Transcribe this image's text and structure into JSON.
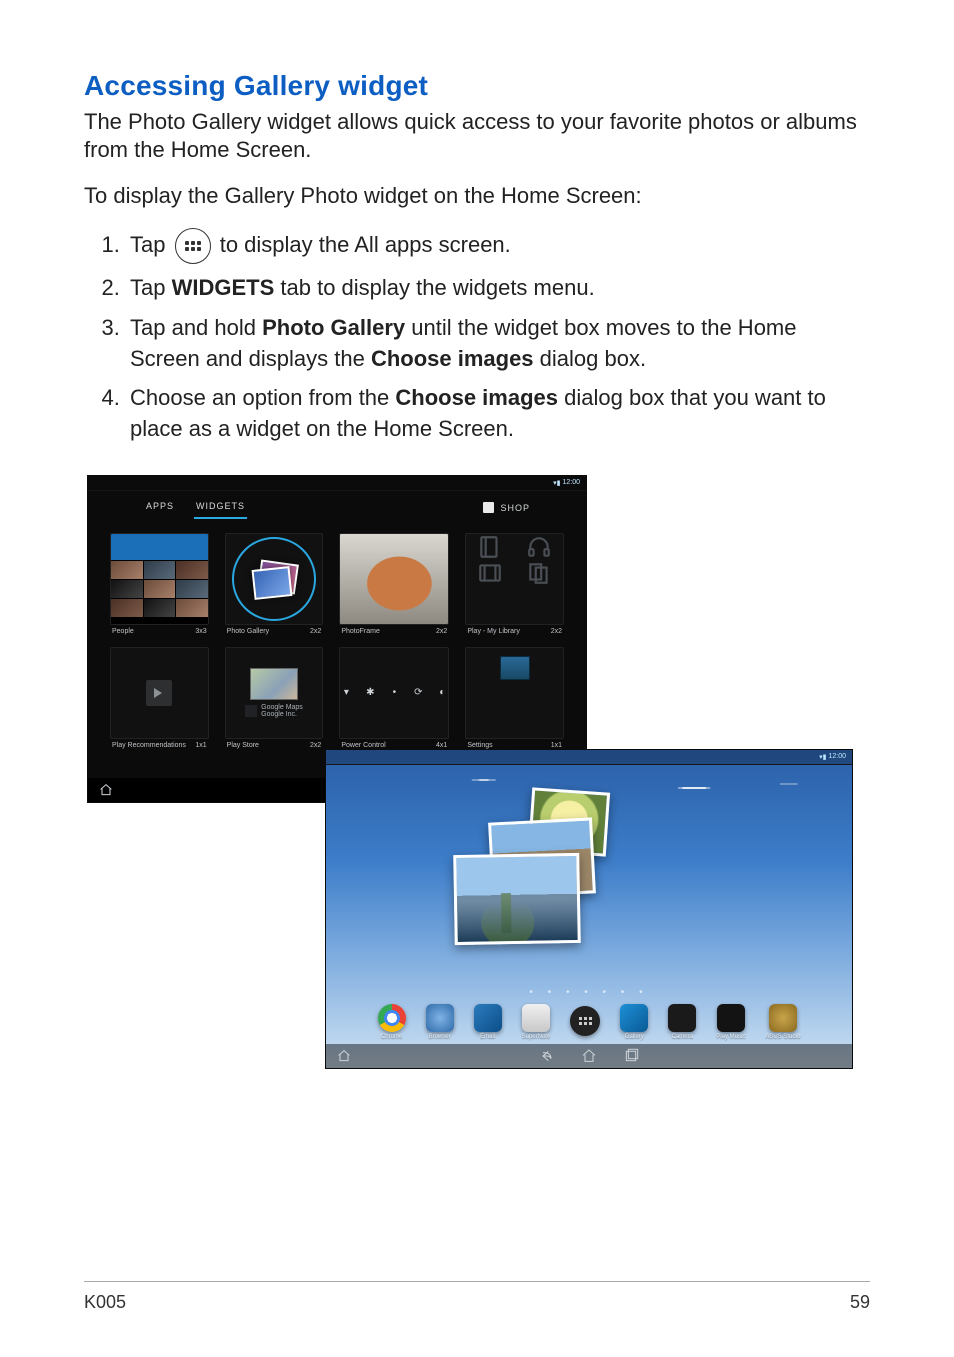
{
  "heading": "Accessing Gallery widget",
  "intro": "The Photo Gallery widget allows quick access to your favorite photos or albums from the Home Screen.",
  "lead2": "To display the Gallery Photo widget on the Home Screen:",
  "steps": {
    "s1a": "Tap ",
    "s1b": " to display the All apps screen.",
    "s2a": "Tap ",
    "s2b": "WIDGETS",
    "s2c": " tab to display the widgets menu.",
    "s3a": "Tap and hold ",
    "s3b": "Photo Gallery",
    "s3c": " until the widget box moves to the Home Screen and displays the ",
    "s3d": "Choose images",
    "s3e": " dialog box.",
    "s4a": "Choose an option from the ",
    "s4b": "Choose images",
    "s4c": " dialog box that you want to place as a widget on the Home Screen."
  },
  "widgets_screen": {
    "status_time": "12:00",
    "tabs": {
      "apps": "APPS",
      "widgets": "WIDGETS"
    },
    "shop": "SHOP",
    "cards": {
      "people": {
        "name": "People",
        "size": "3x3"
      },
      "photogallery": {
        "name": "Photo Gallery",
        "size": "2x2"
      },
      "photoframe": {
        "name": "PhotoFrame",
        "size": "2x2"
      },
      "mylibrary": {
        "name": "Play - My Library",
        "size": "2x2"
      },
      "playrec": {
        "name": "Play Recommendations",
        "size": "1x1"
      },
      "playstore": {
        "name": "Play Store",
        "size": "2x2",
        "featured": "Google Maps",
        "publisher": "Google Inc."
      },
      "powercontrol": {
        "name": "Power Control",
        "size": "4x1"
      },
      "settings": {
        "name": "Settings",
        "size": "1x1"
      }
    }
  },
  "home_screen": {
    "status_time": "12:00",
    "dock": {
      "chrome": "Chrome",
      "browser": "Browser",
      "email": "Email",
      "supernote": "SuperNote",
      "apps": "",
      "gallery": "Gallery",
      "camera": "Camera",
      "playmusic": "Play Music",
      "studio": "ASUS Studio"
    }
  },
  "footer": {
    "model": "K005",
    "page": "59"
  }
}
